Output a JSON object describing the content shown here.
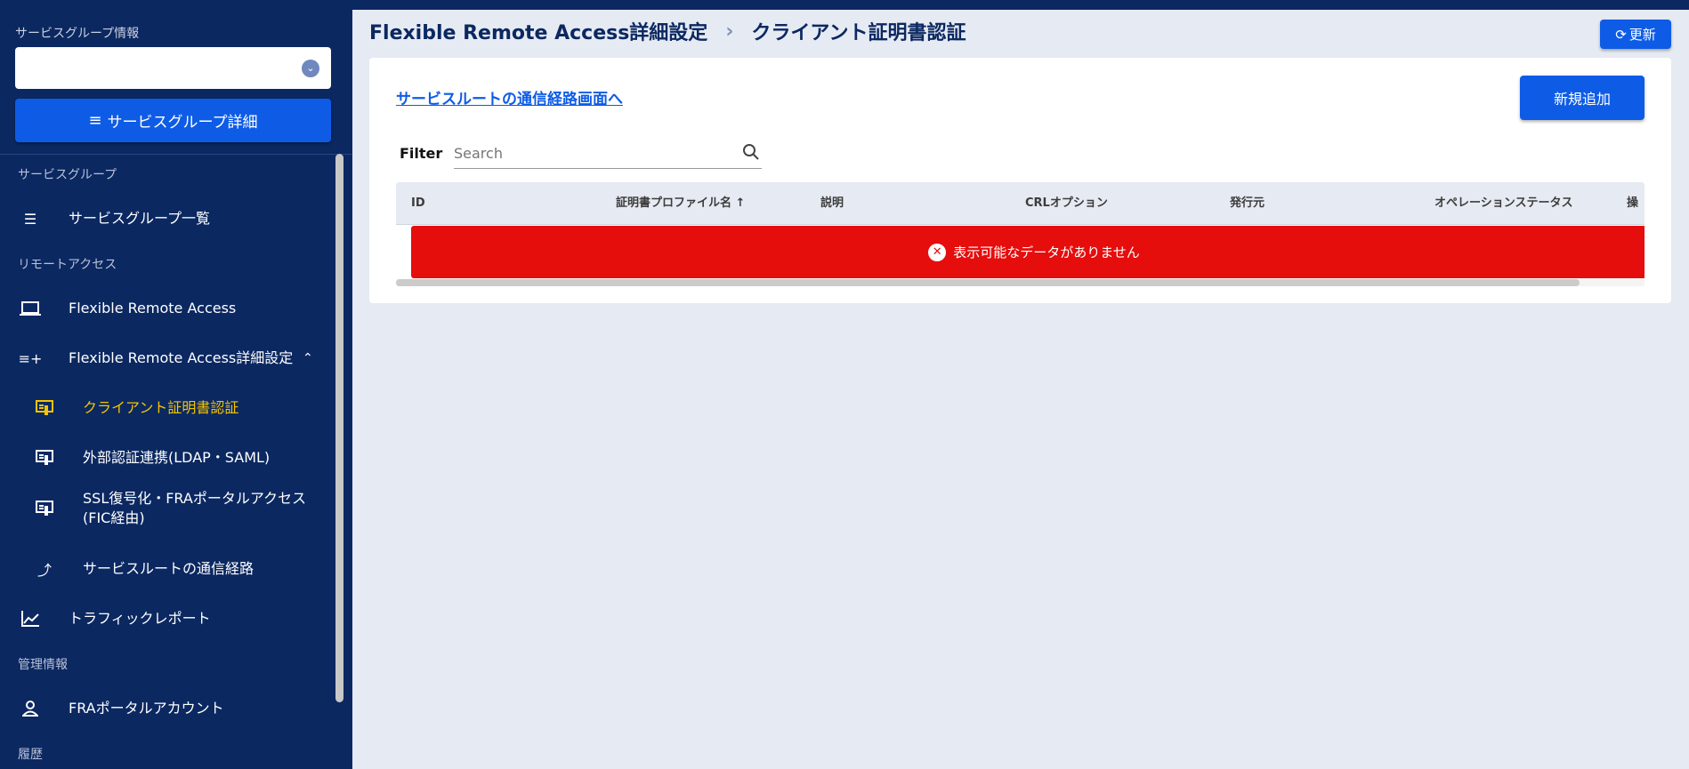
{
  "sidebar": {
    "service_group_info_label": "サービスグループ情報",
    "select_value": "",
    "detail_button": "サービスグループ詳細",
    "sections": [
      "サービスグループ",
      "リモートアクセス",
      "管理情報",
      "履歴"
    ],
    "items": [
      {
        "label": "サービスグループ一覧",
        "icon": "list-icon"
      },
      {
        "label": "Flexible Remote Access",
        "icon": "laptop-icon"
      },
      {
        "label": "Flexible Remote Access詳細設定",
        "icon": "playlist-add-icon"
      },
      {
        "label": "クライアント証明書認証",
        "icon": "certificate-icon"
      },
      {
        "label": "外部認証連携(LDAP・SAML)",
        "icon": "certificate-icon"
      },
      {
        "label": "SSL復号化・FRAポータルアクセス(FIC経由)",
        "icon": "certificate-icon"
      },
      {
        "label": "サービスルートの通信経路",
        "icon": "turn-up-icon"
      },
      {
        "label": "トラフィックレポート",
        "icon": "chart-line-icon"
      },
      {
        "label": "FRAポータルアカウント",
        "icon": "user-icon"
      }
    ]
  },
  "header": {
    "breadcrumb_parent": "Flexible Remote Access詳細設定",
    "separator": "›",
    "title": "クライアント証明書認証",
    "refresh_button": "更新"
  },
  "main": {
    "route_link": "サービスルートの通信経路画面へ",
    "add_button": "新規追加",
    "filter_label": "Filter",
    "search_placeholder": "Search",
    "search_value": "",
    "columns": [
      "ID",
      "証明書プロファイル名 ↑",
      "説明",
      "CRLオプション",
      "発行元",
      "オペレーションステータス",
      "操"
    ],
    "empty_message": "表示可能なデータがありません"
  },
  "colors": {
    "navy": "#0b2861",
    "accent": "#0e5ce6",
    "active": "#f5c400",
    "error": "#e60d0d"
  }
}
